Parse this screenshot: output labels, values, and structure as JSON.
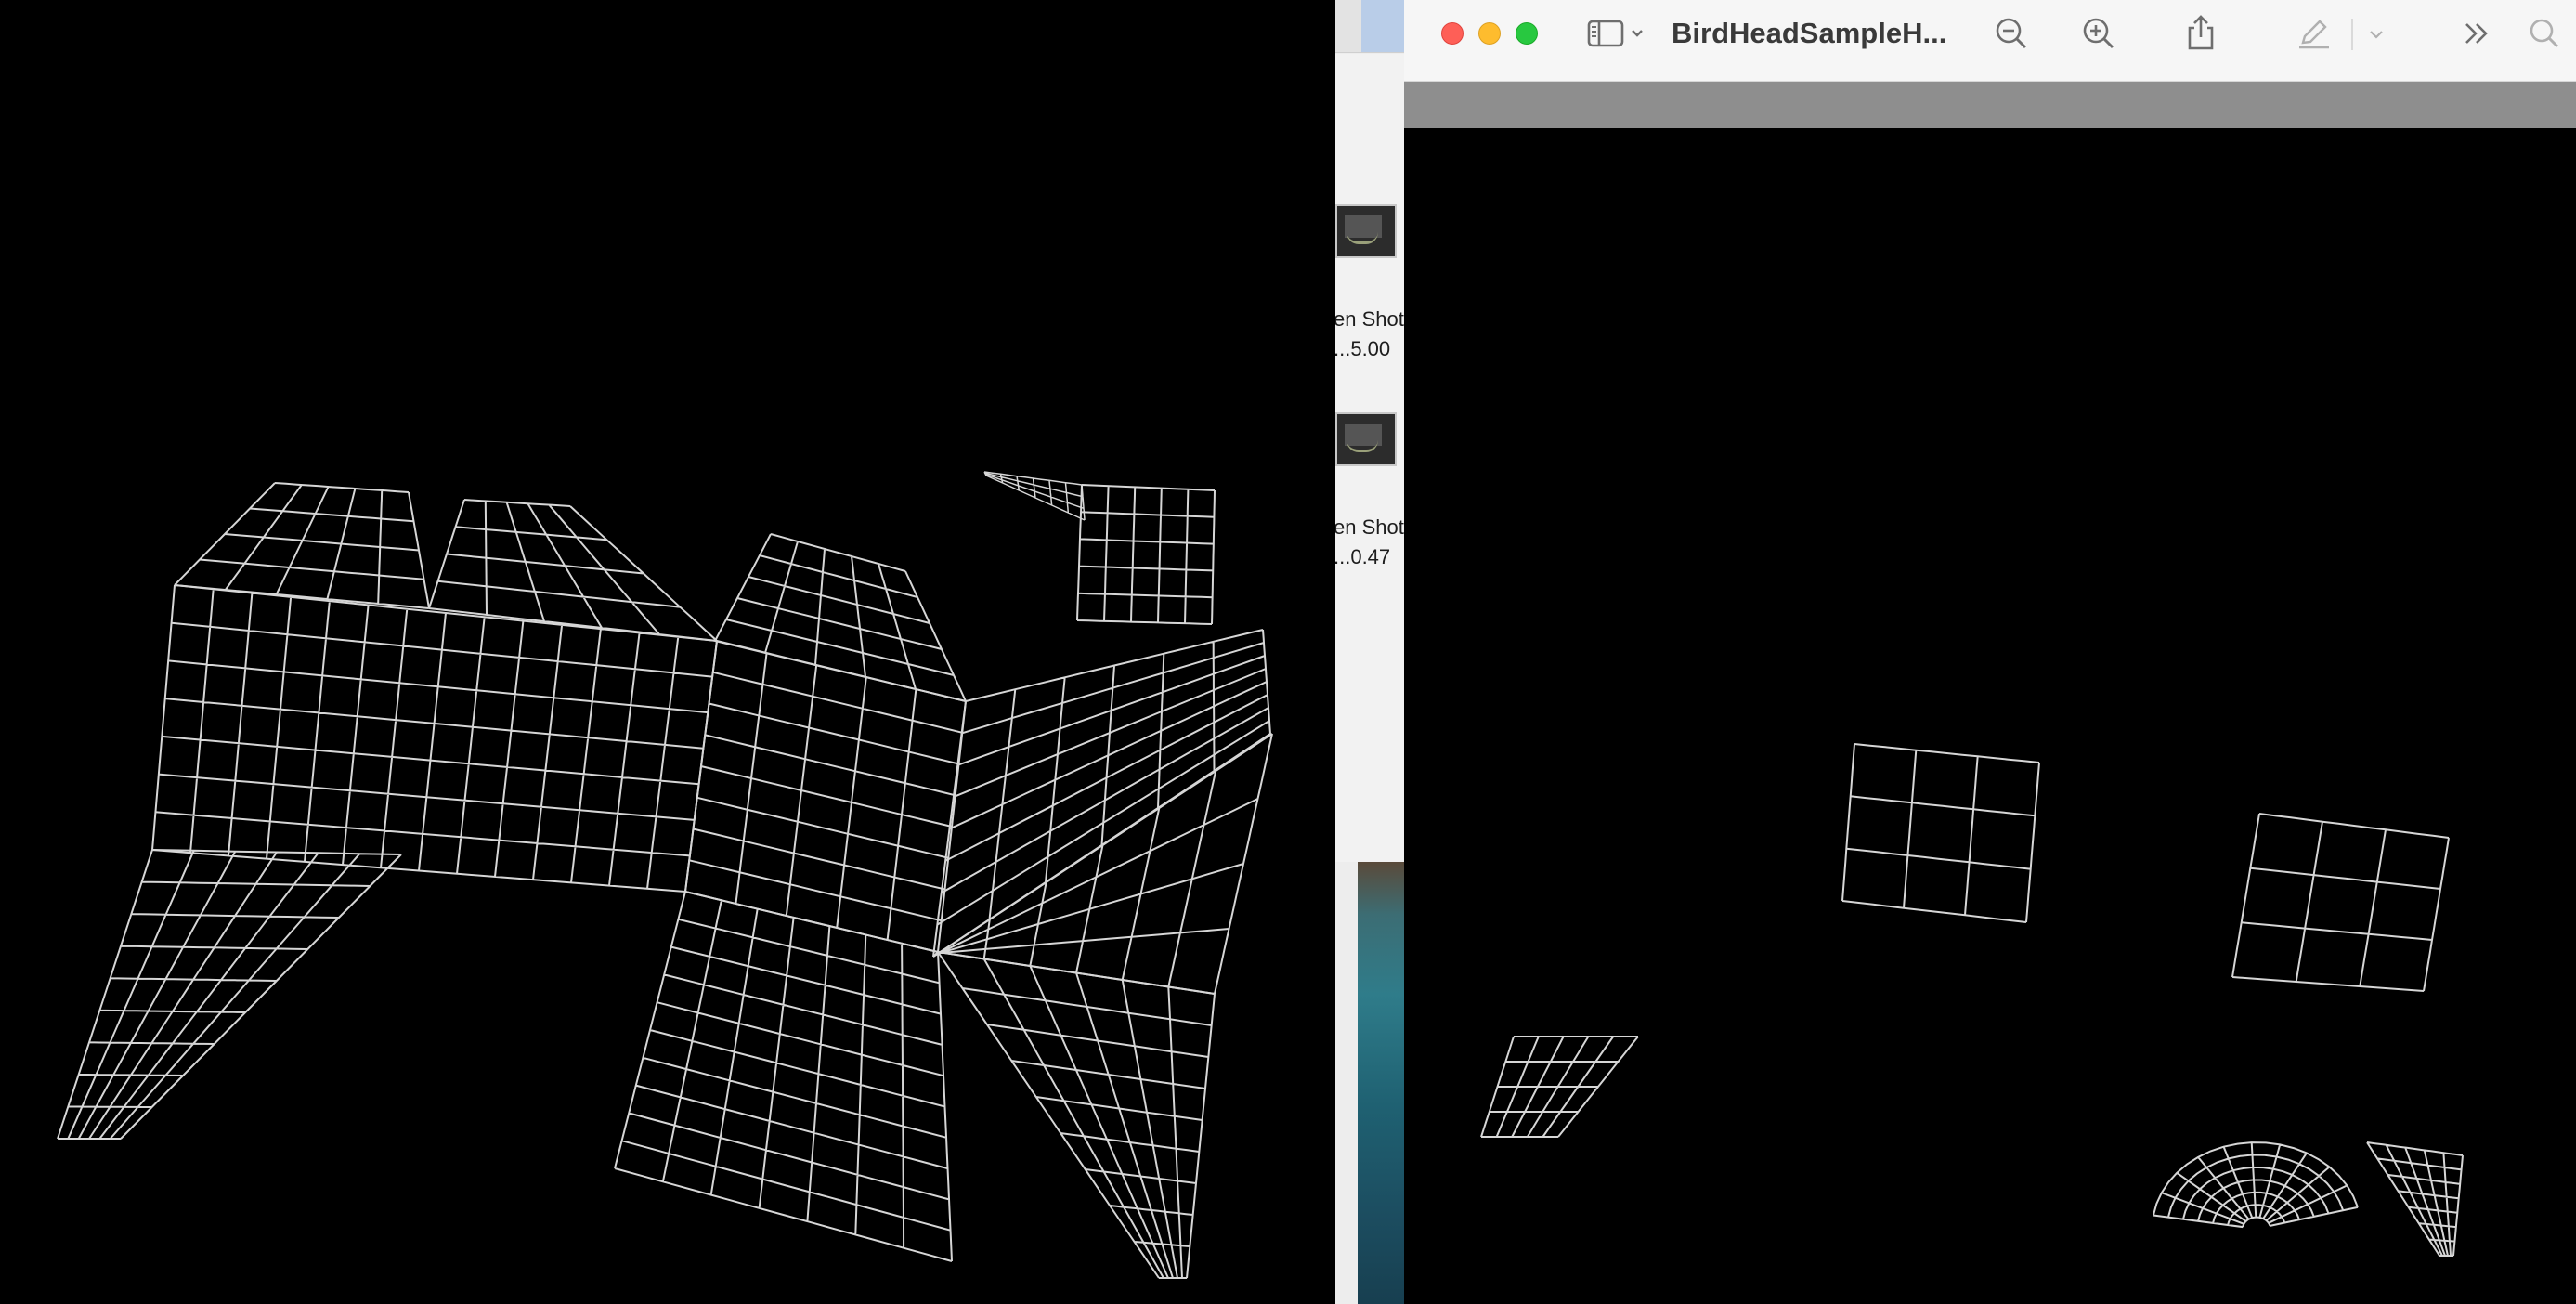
{
  "window": {
    "title": "BirdHeadSampleH..."
  },
  "finder": {
    "items": [
      {
        "label_line1": "en Shot",
        "label_line2": "...5.00 "
      },
      {
        "label_line1": "en Shot",
        "label_line2": "...0.47 "
      }
    ]
  },
  "toolbar": {
    "icons": [
      "sidebar-icon",
      "chevron-down-icon",
      "zoom-out-icon",
      "zoom-in-icon",
      "share-icon",
      "markup-pen-icon",
      "chevron-down-icon",
      "more-chevrons-icon",
      "search-icon"
    ]
  },
  "colors": {
    "mesh": "#d6d6d6",
    "background": "#000000",
    "titlebar": "#f6f6f6"
  }
}
